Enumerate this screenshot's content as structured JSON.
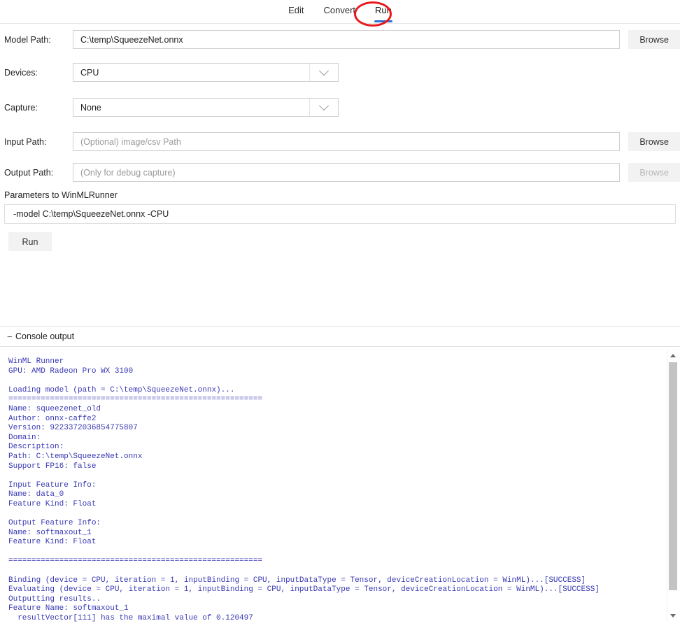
{
  "tabs": [
    {
      "label": "Edit",
      "active": false
    },
    {
      "label": "Convert",
      "active": false
    },
    {
      "label": "Run",
      "active": true
    }
  ],
  "annotation": {
    "shape": "ellipse",
    "color": "#e8191c",
    "target": "Run"
  },
  "accent_color": "#2f6fd0",
  "form": {
    "model_path": {
      "label": "Model Path:",
      "value": "C:\\temp\\SqueezeNet.onnx",
      "browse_label": "Browse",
      "browse_disabled": false
    },
    "devices": {
      "label": "Devices:",
      "value": "CPU"
    },
    "capture": {
      "label": "Capture:",
      "value": "None"
    },
    "input_path": {
      "label": "Input Path:",
      "value": "",
      "placeholder": "(Optional) image/csv Path",
      "browse_label": "Browse",
      "browse_disabled": false
    },
    "output_path": {
      "label": "Output Path:",
      "value": "",
      "placeholder": "(Only for debug capture)",
      "browse_label": "Browse",
      "browse_disabled": true
    },
    "parameters": {
      "label": "Parameters to WinMLRunner",
      "value": "-model C:\\temp\\SqueezeNet.onnx -CPU"
    },
    "run_button": "Run"
  },
  "console": {
    "header_label": "Console output",
    "collapse_glyph": "−",
    "text_color": "#3a3ab4",
    "output": "WinML Runner\nGPU: AMD Radeon Pro WX 3100\n\nLoading model (path = C:\\temp\\SqueezeNet.onnx)...\n=======================================================\nName: squeezenet_old\nAuthor: onnx-caffe2\nVersion: 9223372036854775807\nDomain:\nDescription:\nPath: C:\\temp\\SqueezeNet.onnx\nSupport FP16: false\n\nInput Feature Info:\nName: data_0\nFeature Kind: Float\n\nOutput Feature Info:\nName: softmaxout_1\nFeature Kind: Float\n\n=======================================================\n\nBinding (device = CPU, iteration = 1, inputBinding = CPU, inputDataType = Tensor, deviceCreationLocation = WinML)...[SUCCESS]\nEvaluating (device = CPU, iteration = 1, inputBinding = CPU, inputDataType = Tensor, deviceCreationLocation = WinML)...[SUCCESS]\nOutputting results..\nFeature Name: softmaxout_1\n  resultVector[111] has the maximal value of 0.120497"
  }
}
